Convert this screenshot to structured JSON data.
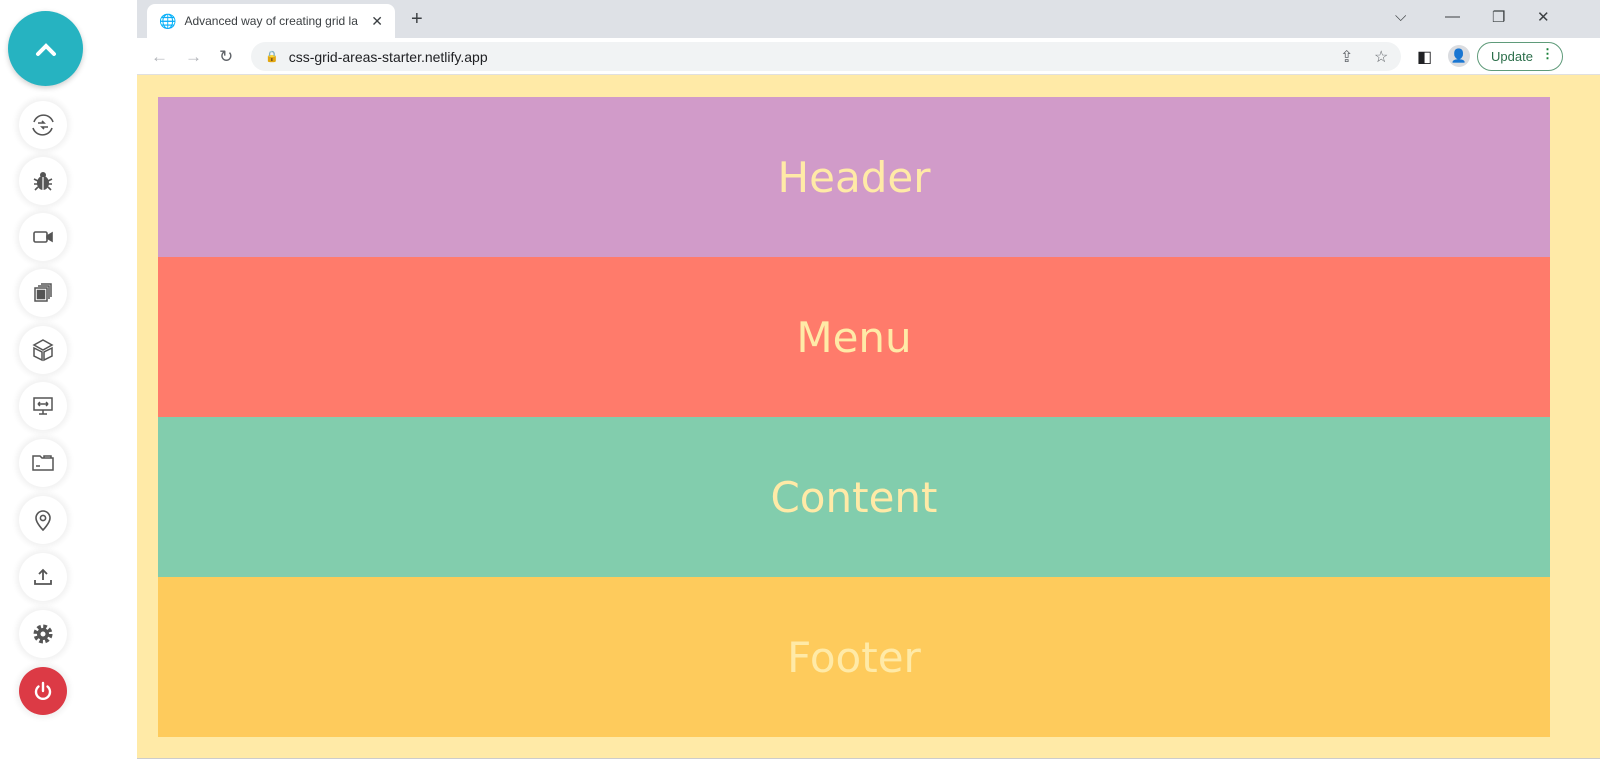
{
  "sidebar": {
    "scroll_top_icon": "chevron-up-icon",
    "buttons": [
      {
        "icon": "switch-icon"
      },
      {
        "icon": "bug-icon"
      },
      {
        "icon": "video-camera-icon"
      },
      {
        "icon": "gallery-icon"
      },
      {
        "icon": "cube-icon"
      },
      {
        "icon": "screen-share-icon"
      },
      {
        "icon": "folder-icon"
      },
      {
        "icon": "location-pin-icon"
      },
      {
        "icon": "upload-icon"
      },
      {
        "icon": "gear-icon"
      },
      {
        "icon": "power-icon"
      }
    ]
  },
  "browser": {
    "tab_title": "Advanced way of creating grid la",
    "url": "css-grid-areas-starter.netlify.app",
    "update_label": "Update"
  },
  "page": {
    "areas": [
      {
        "label": "Header",
        "color": "#d19bc9"
      },
      {
        "label": "Menu",
        "color": "#ff7b6b"
      },
      {
        "label": "Content",
        "color": "#82cdad"
      },
      {
        "label": "Footer",
        "color": "#fecb5c"
      }
    ]
  }
}
